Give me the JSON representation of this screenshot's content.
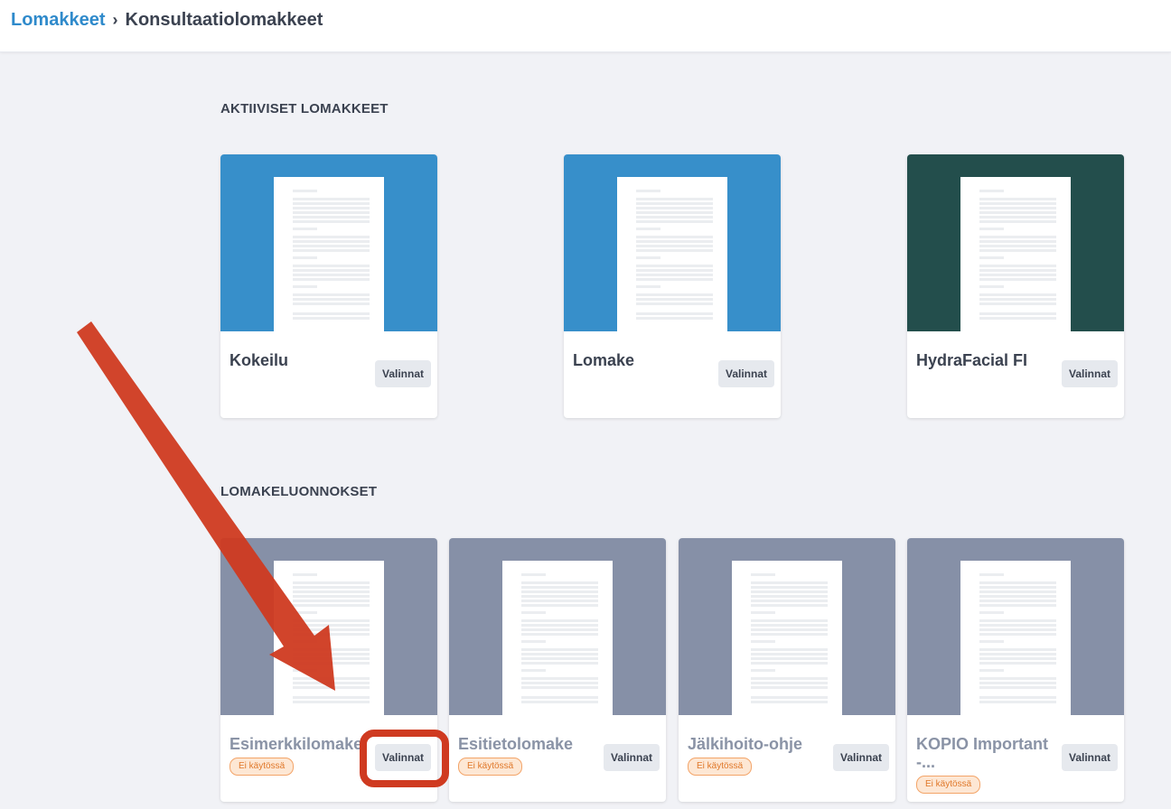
{
  "breadcrumb": {
    "parent": "Lomakkeet",
    "separator": "›",
    "current": "Konsultaatiolomakkeet"
  },
  "sections": {
    "active_title": "AKTIIVISET LOMAKKEET",
    "drafts_title": "LOMAKELUONNOKSET"
  },
  "active_forms": [
    {
      "name": "Kokeilu",
      "options_label": "Valinnat",
      "thumb_color": "#378fca"
    },
    {
      "name": "Lomake",
      "options_label": "Valinnat",
      "thumb_color": "#378fca"
    },
    {
      "name": "HydraFacial FI",
      "options_label": "Valinnat",
      "thumb_color": "#234e4c"
    }
  ],
  "draft_forms": [
    {
      "name": "Esimerkkilomake",
      "options_label": "Valinnat",
      "status": "Ei käytössä",
      "thumb_color": "#8690a7"
    },
    {
      "name": "Esitietolomake",
      "options_label": "Valinnat",
      "status": "Ei käytössä",
      "thumb_color": "#8690a7"
    },
    {
      "name": "Jälkihoito-ohje",
      "options_label": "Valinnat",
      "status": "Ei käytössä",
      "thumb_color": "#8690a7"
    },
    {
      "name": "KOPIO Important -...",
      "options_label": "Valinnat",
      "status": "Ei käytössä",
      "thumb_color": "#8690a7"
    }
  ],
  "annotation": {
    "color": "#cf3a20"
  }
}
